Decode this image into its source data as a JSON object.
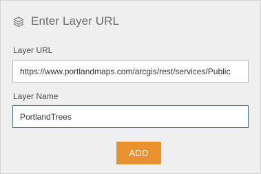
{
  "header": {
    "title": "Enter Layer URL",
    "icon": "layers-icon"
  },
  "layer_url": {
    "label": "Layer URL",
    "value": "https://www.portlandmaps.com/arcgis/rest/services/Public"
  },
  "layer_name": {
    "label": "Layer Name",
    "value": "PortlandTrees"
  },
  "actions": {
    "add_label": "ADD"
  },
  "colors": {
    "panel_background": "#efefef",
    "title_text": "#6b6b6b",
    "add_button": "#e8912e",
    "active_field_border": "#4b6a8c"
  }
}
